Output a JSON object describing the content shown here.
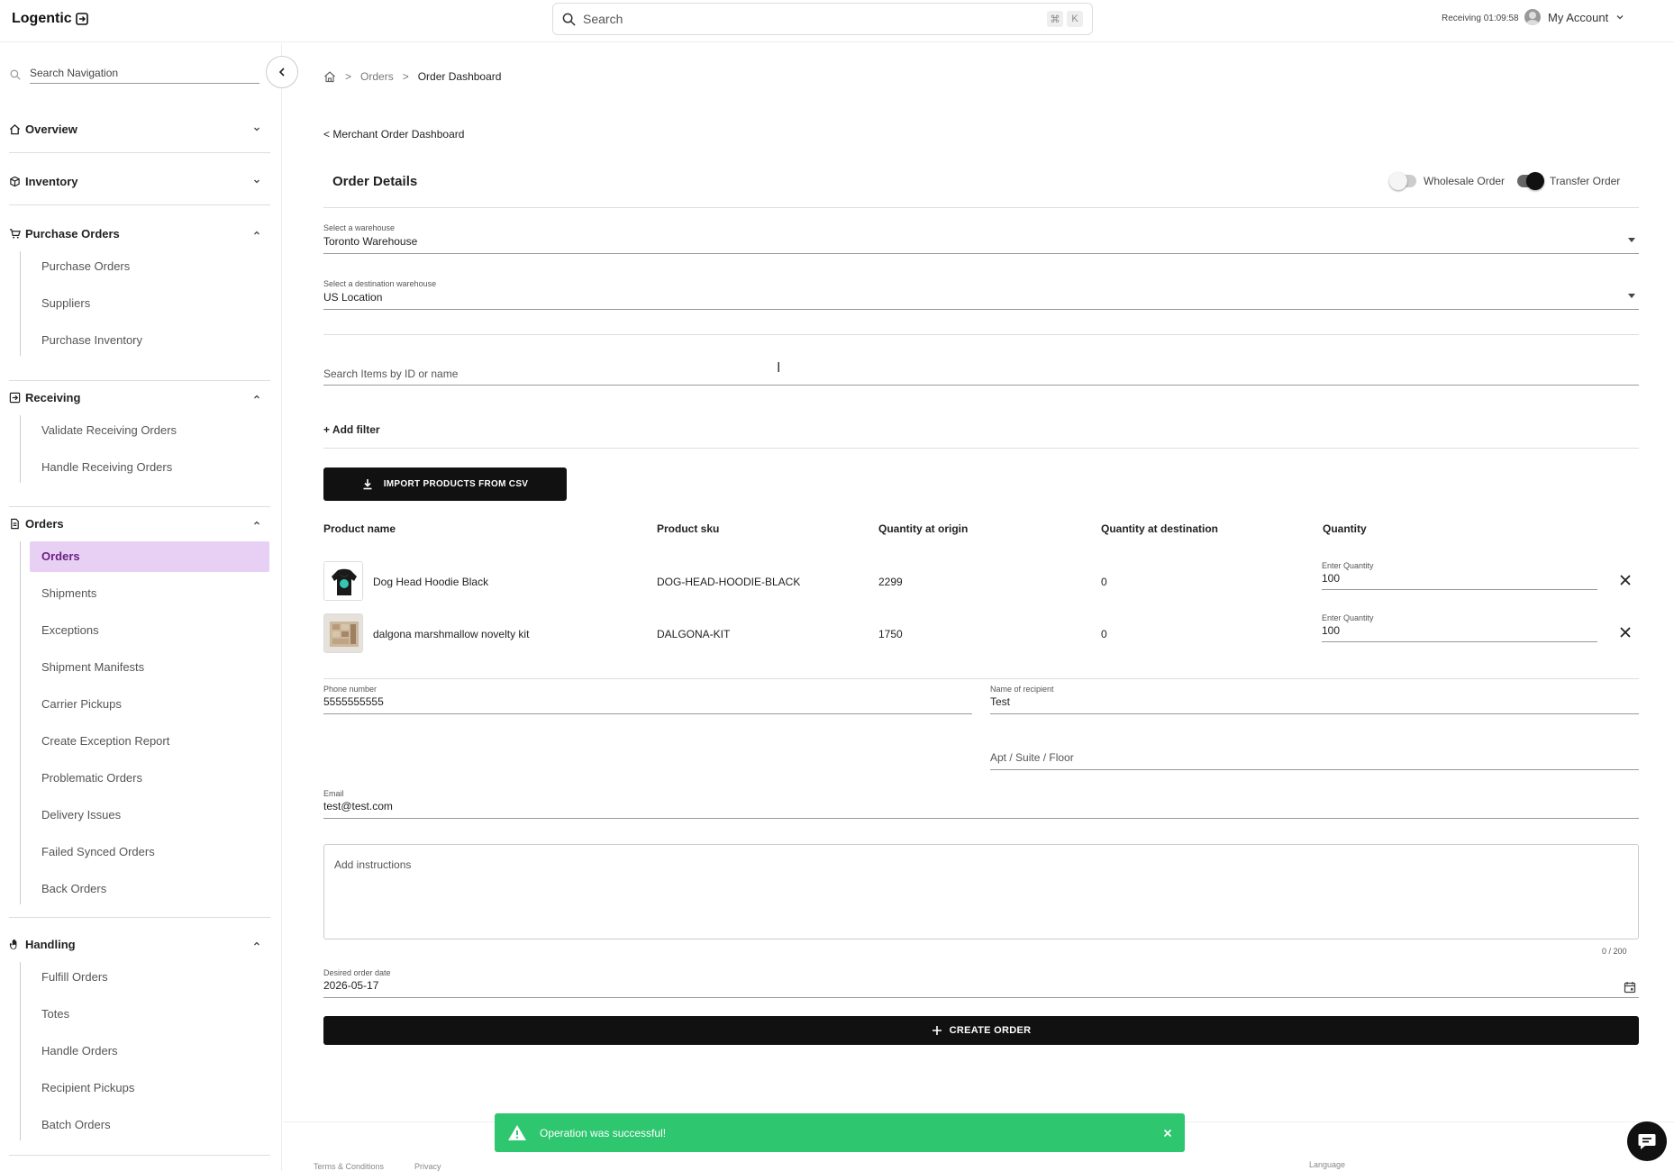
{
  "header": {
    "logo": "Logentic",
    "search_placeholder": "Search",
    "kbd_cmd": "⌘",
    "kbd_k": "K",
    "receiving_timer": "Receiving 01:09:58",
    "account_label": "My Account"
  },
  "sidebar": {
    "search_placeholder": "Search Navigation",
    "sections": {
      "overview": {
        "label": "Overview",
        "icon": "home-icon"
      },
      "inventory": {
        "label": "Inventory",
        "icon": "box-icon"
      },
      "purchase_orders": {
        "label": "Purchase Orders",
        "icon": "cart-icon",
        "items": [
          "Purchase Orders",
          "Suppliers",
          "Purchase Inventory"
        ]
      },
      "receiving": {
        "label": "Receiving",
        "icon": "receiving-icon",
        "items": [
          "Validate Receiving Orders",
          "Handle Receiving Orders"
        ]
      },
      "orders": {
        "label": "Orders",
        "icon": "document-icon",
        "items": [
          "Orders",
          "Shipments",
          "Exceptions",
          "Shipment Manifests",
          "Carrier Pickups",
          "Create Exception Report",
          "Problematic Orders",
          "Delivery Issues",
          "Failed Synced Orders",
          "Back Orders"
        ],
        "active": "Orders"
      },
      "handling": {
        "label": "Handling",
        "icon": "hand-icon",
        "items": [
          "Fulfill Orders",
          "Totes",
          "Handle Orders",
          "Recipient Pickups",
          "Batch Orders"
        ]
      }
    }
  },
  "breadcrumb": {
    "level1": "Orders",
    "current": "Order Dashboard"
  },
  "back_link": "< Merchant Order Dashboard",
  "page_title": "Order Details",
  "toggles": {
    "wholesale": "Wholesale Order",
    "transfer": "Transfer Order",
    "wholesale_on": false,
    "transfer_on": true
  },
  "warehouse": {
    "label": "Select a warehouse",
    "value": "Toronto Warehouse"
  },
  "destination": {
    "label": "Select a destination warehouse",
    "value": "US Location"
  },
  "item_search_placeholder": "Search Items by ID or name",
  "add_filter": "+ Add filter",
  "import_button": "IMPORT PRODUCTS FROM CSV",
  "table": {
    "headers": {
      "name": "Product name",
      "sku": "Product sku",
      "origin": "Quantity at origin",
      "destination": "Quantity at destination",
      "quantity": "Quantity"
    },
    "rows": [
      {
        "name": "Dog Head Hoodie Black",
        "sku": "DOG-HEAD-HOODIE-BLACK",
        "origin": "2299",
        "destination": "0",
        "qty_label": "Enter Quantity",
        "qty": "100"
      },
      {
        "name": "dalgona marshmallow novelty kit",
        "sku": "DALGONA-KIT",
        "origin": "1750",
        "destination": "0",
        "qty_label": "Enter Quantity",
        "qty": "100"
      }
    ]
  },
  "recipient": {
    "phone_label": "Phone number",
    "phone": "5555555555",
    "name_label": "Name of recipient",
    "name": "Test",
    "apt_placeholder": "Apt / Suite / Floor",
    "email_label": "Email",
    "email": "test@test.com"
  },
  "instructions_placeholder": "Add instructions",
  "instructions_counter": "0 / 200",
  "desired_date": {
    "label": "Desired order date",
    "value": "2026-05-17"
  },
  "create_button": "CREATE ORDER",
  "footer": {
    "terms": "Terms & Conditions",
    "privacy": "Privacy",
    "language": "Language"
  },
  "toast": {
    "message": "Operation was successful!"
  },
  "colors": {
    "active_nav_bg": "#e8d0f4",
    "active_nav_text": "#6b1f85",
    "toast_bg": "#2ec66f",
    "primary_button": "#111111"
  }
}
